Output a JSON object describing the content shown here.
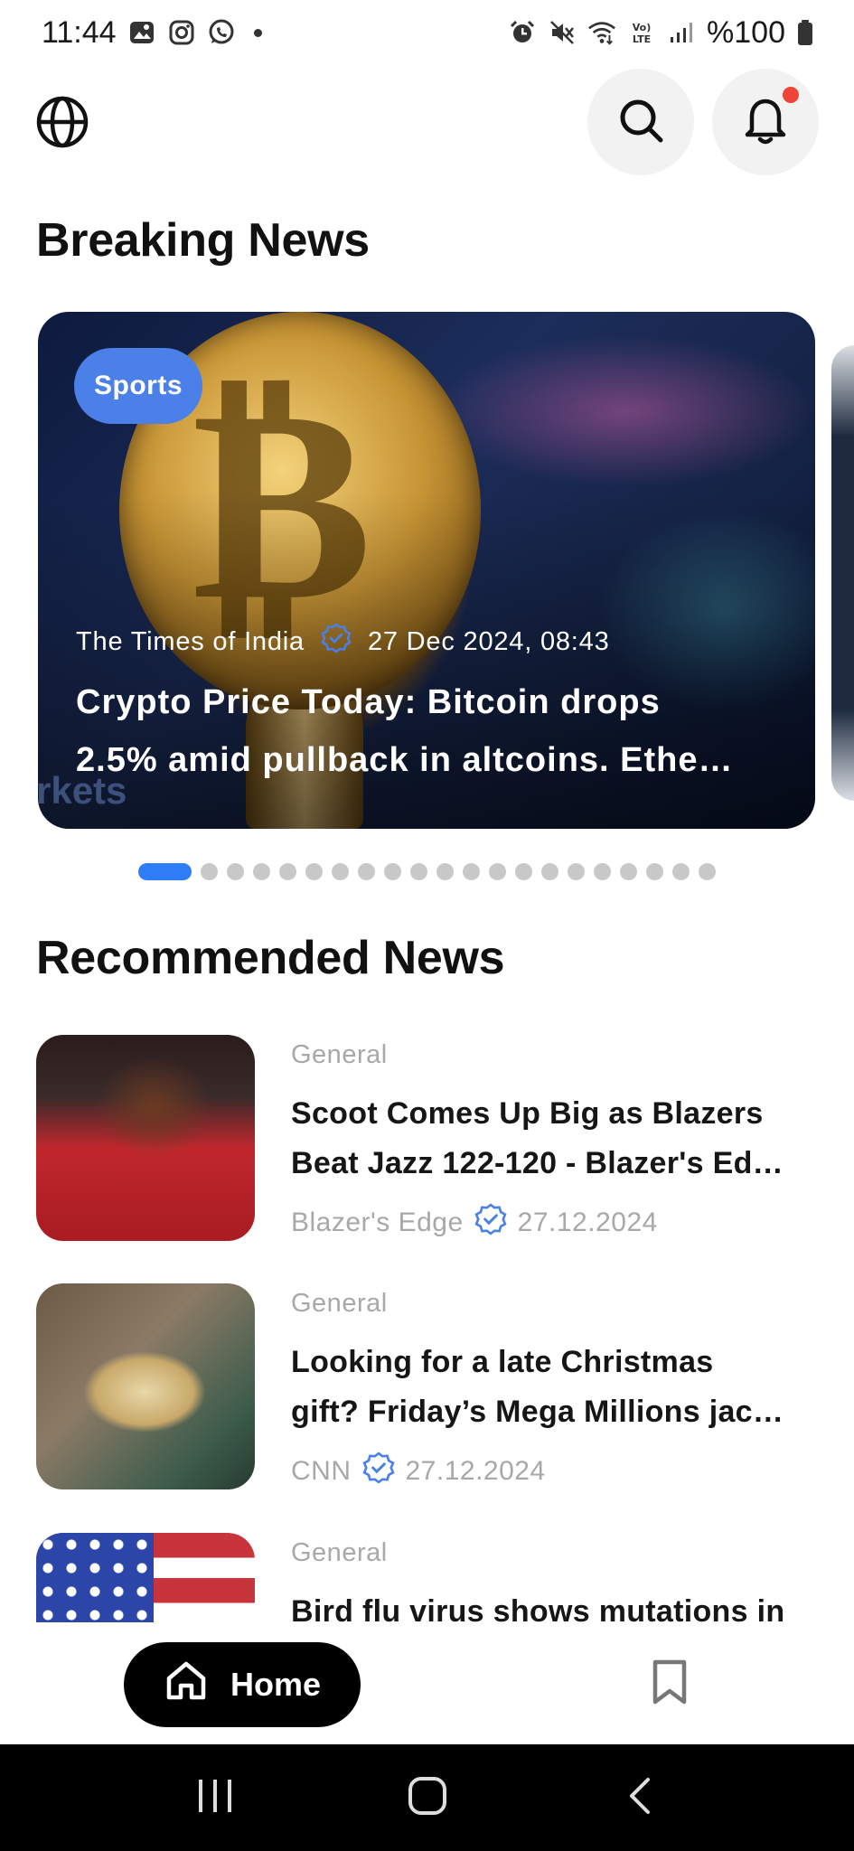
{
  "status_bar": {
    "time": "11:44",
    "battery": "%100",
    "left_icons": [
      "gallery-icon",
      "instagram-icon",
      "whatsapp-icon",
      "dot"
    ],
    "right_icons": [
      "alarm-icon",
      "mute-icon",
      "wifi-icon",
      "volte-icon",
      "signal-icon",
      "battery-icon"
    ]
  },
  "header": {
    "icons": [
      "globe-icon",
      "search-icon",
      "bell-icon"
    ],
    "has_notification": true
  },
  "breaking": {
    "title": "Breaking News",
    "card": {
      "category": "Sports",
      "source": "The Times of India",
      "date": "27 Dec 2024, 08:43",
      "title_line1": "Crypto Price Today: Bitcoin drops",
      "title_line2": "2.5% amid pullback in altcoins. Ethe…",
      "watermark": "rkets"
    },
    "pager": {
      "total": 21,
      "active_index": 0
    }
  },
  "recommended": {
    "title": "Recommended News",
    "items": [
      {
        "category": "General",
        "title_line1": "Scoot Comes Up Big as Blazers",
        "title_line2": "Beat Jazz 122-120 - Blazer's Ed…",
        "source": "Blazer's Edge",
        "date": "27.12.2024"
      },
      {
        "category": "General",
        "title_line1": "Looking for a late Christmas",
        "title_line2": "gift? Friday’s Mega Millions jac…",
        "source": "CNN",
        "date": "27.12.2024"
      },
      {
        "category": "General",
        "title_line1": "Bird flu virus shows mutations in",
        "title_line2": "",
        "source": "",
        "date": ""
      }
    ]
  },
  "bottom_nav": {
    "home_label": "Home",
    "icons": [
      "home-icon",
      "bookmark-icon"
    ]
  },
  "colors": {
    "accent": "#2f7df6",
    "tag": "#4a80e8",
    "notification": "#f04438",
    "muted_text": "#a8a8a8",
    "verified": "#4a80e8"
  }
}
